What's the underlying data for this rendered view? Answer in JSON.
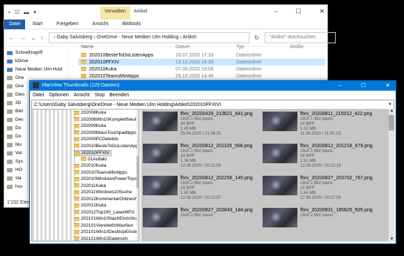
{
  "explorer": {
    "qat_icons": [
      "save-icon",
      "checkbox-icon",
      "folder-icon",
      "dropdown-icon"
    ],
    "context_tab": "Verwalten",
    "context_title": "Artikel",
    "controls": [
      "–",
      "☐",
      "✕"
    ],
    "ribbon": {
      "file": "Datei",
      "tabs": [
        "Start",
        "Freigeben",
        "Ansicht",
        "Bildtools"
      ]
    },
    "nav_buttons": [
      "←",
      "→",
      "⌄",
      "↑"
    ],
    "breadcrumb": "›  Gaby Salvisberg › OneDrive - Neue Medien Ulm Holding › Artikel",
    "refresh": "↻",
    "search_placeholder": "\"Artikel\" durchsuchen",
    "sidebar": [
      "Schnellzugriff",
      "kDrive",
      "Neue Medien Ulm Hold",
      "One",
      "One",
      "Dies",
      "3D",
      "Bild",
      "Des",
      "Do",
      "Do",
      "Mu",
      "Vid",
      "Sys",
      "HO",
      "sta",
      "hos"
    ],
    "columns": {
      "name": "Name",
      "date": "Datum",
      "type": "Typ",
      "size": "Größe"
    },
    "files": [
      {
        "name": "202010BesteToDoListenApps",
        "date": "16.07.2020 17:33",
        "type": "Dateiordner"
      },
      {
        "name": "202010FFXIV",
        "date": "13.10.2020 14:36",
        "type": "Dateiordner"
      },
      {
        "name": "202010Kuka",
        "date": "07.08.2020 19:09",
        "type": "Dateiordner"
      },
      {
        "name": "202010TeamsMinitipps",
        "date": "29.10.2020 14:46",
        "type": "Dateiordner"
      }
    ],
    "status": "1'152 Elem"
  },
  "irfan": {
    "title": "IrfanView Thumbnails (129 Dateien)",
    "controls": [
      "–",
      "☐",
      "✕"
    ],
    "menu": [
      "Datei",
      "Optionen",
      "Ansicht",
      "Stop",
      "Beenden"
    ],
    "path": "C:\\Users\\Gaby Salvisberg\\OneDrive - Neue Medien Ulm Holding\\Artikel\\202010FFXIV\\",
    "tree": [
      "202008Kuka",
      "202008Win10KomplettNeuIn",
      "202009Kuka",
      "202009MausTouchpadtipps",
      "202009PCDetektiv",
      "202010BesteToDoListenApps",
      "202010FFXIV",
      "01Auflakt",
      "202010Kuka",
      "202010TeamsMinitipps",
      "202010WindowsPowerToys",
      "202011Kuka",
      "202011Windows10Suche",
      "202012KommentarOnlineshop",
      "202012Kuka",
      "202012Top100_LaserMFG",
      "202101Win10NachEinrichtung",
      "202101VierebeflzWasNun",
      "202101Win10DesktopEinstell",
      "202101Win10Datensch"
    ],
    "thumbs": [
      {
        "name": "ffxiv_20200429_213621_841.png",
        "res": "1920 x 992 pixels",
        "bits": "24 BPP",
        "size": "2.49 MB",
        "date": "29.04.2020 / 21:36:21"
      },
      {
        "name": "ffxiv_20200811_215012_422.png",
        "res": "1920 x 992 pixels",
        "bits": "24 BPP",
        "size": "1.52 MB",
        "date": "11.08.2020 / 21:50:13"
      },
      {
        "name": "ffxiv_20200812_201105_568.png",
        "res": "1920 x 992 pixels",
        "bits": "24 BPP",
        "size": "1.36 MB",
        "date": "12.08.2020 / 20:11:06"
      },
      {
        "name": "ffxiv_20200812_201218_679.png",
        "res": "1920 x 992 pixels",
        "bits": "24 BPP",
        "size": "2.51 MB",
        "date": "12.08.2020 / 20:12:19"
      },
      {
        "name": "ffxiv_20200812_202256_145.png",
        "res": "1920 x 992 pixels",
        "bits": "24 BPP",
        "size": "1.55 MB",
        "date": "12.08.2020 / 20:22:57"
      },
      {
        "name": "ffxiv_20200827_203702_767.png",
        "res": "1920 x 992 pixels",
        "bits": "24 BPP",
        "size": "2.64 MB",
        "date": "27.08.2020 / 20:37:03"
      },
      {
        "name": "ffxiv_20200827_203843_184.png",
        "res": "1920 x 992 pixels",
        "bits": "",
        "size": "",
        "date": ""
      },
      {
        "name": "ffxiv_20200831_185825_505.png",
        "res": "1920 x 992 pixels",
        "bits": "",
        "size": "",
        "date": ""
      }
    ]
  }
}
